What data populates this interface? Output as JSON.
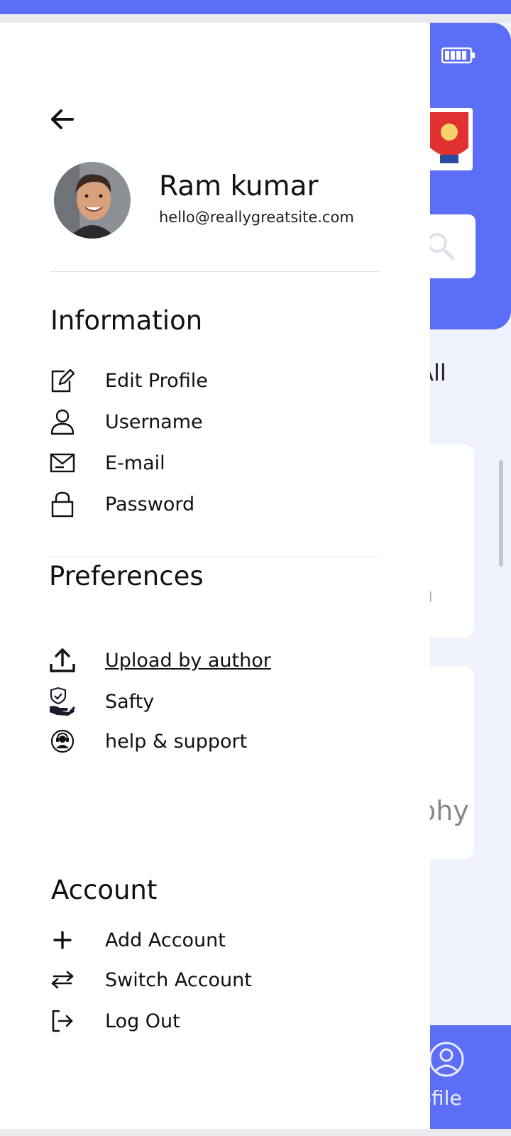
{
  "drawer": {
    "back_icon": "arrow-left-icon",
    "profile": {
      "name": "Ram kumar",
      "email": "hello@reallygreatsite.com"
    },
    "sections": {
      "information": {
        "title": "Information",
        "items": [
          {
            "label": "Edit Profile",
            "icon": "edit-icon"
          },
          {
            "label": "Username",
            "icon": "user-icon"
          },
          {
            "label": "E-mail",
            "icon": "mail-icon"
          },
          {
            "label": "Password",
            "icon": "lock-icon"
          }
        ]
      },
      "preferences": {
        "title": "Preferences",
        "items": [
          {
            "label": "Upload by author",
            "icon": "upload-icon"
          },
          {
            "label": "Safty",
            "icon": "safety-hand-icon"
          },
          {
            "label": "help & support",
            "icon": "support-agent-icon"
          }
        ]
      },
      "account": {
        "title": "Account",
        "items": [
          {
            "label": "Add Account",
            "icon": "plus-icon"
          },
          {
            "label": "Switch Account",
            "icon": "switch-arrows-icon"
          },
          {
            "label": "Log Out",
            "icon": "logout-icon"
          }
        ]
      }
    }
  },
  "background": {
    "view_all_partial": "y All",
    "card1_partial": "n",
    "card2_partial": "phy",
    "nav_profile_partial": "rofile"
  },
  "colors": {
    "accent": "#5b6ef5",
    "background": "#f0f2fd",
    "drawer": "#ffffff"
  }
}
